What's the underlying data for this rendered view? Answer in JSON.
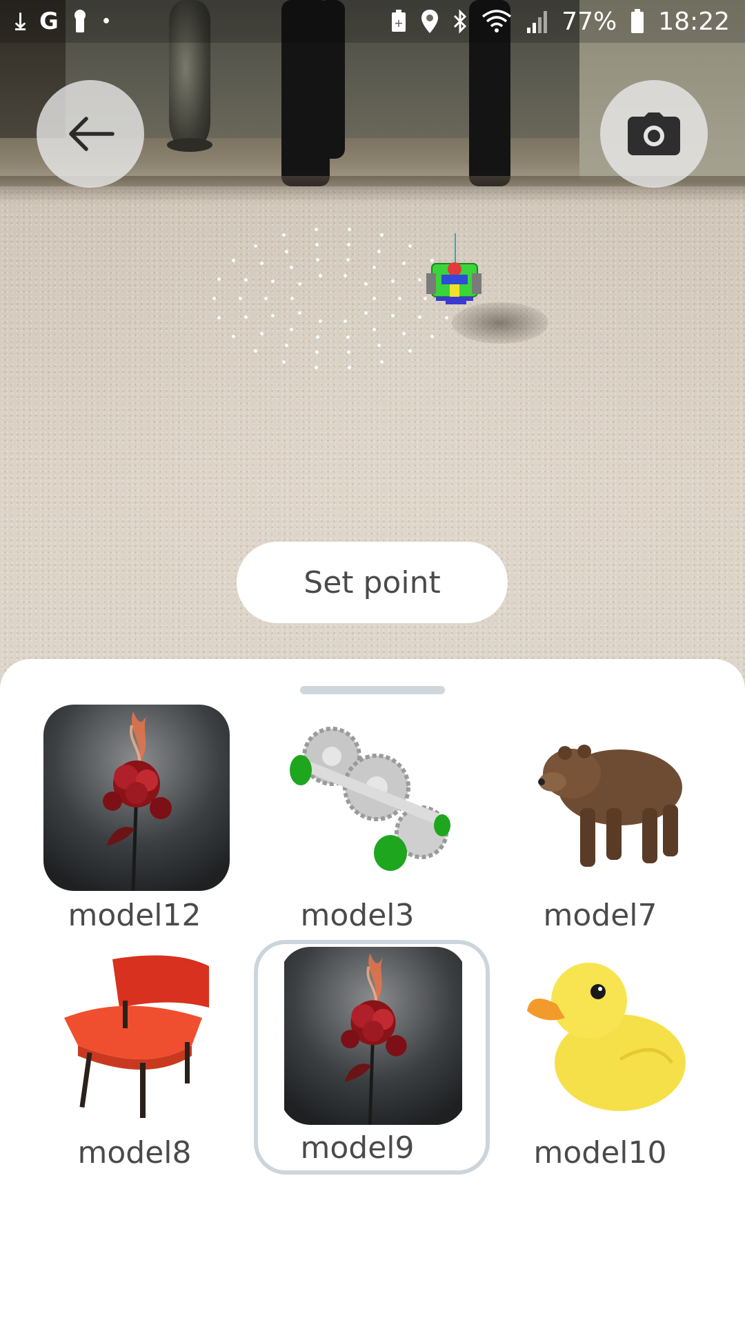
{
  "status_bar": {
    "left_icons": [
      "download-icon",
      "google-icon",
      "keyhole-icon",
      "dot-icon"
    ],
    "right_icons": [
      "battery-saver-icon",
      "location-icon",
      "bluetooth-icon",
      "wifi-icon",
      "signal-icon"
    ],
    "battery_percent": "77%",
    "time": "18:22"
  },
  "toolbar": {
    "back_icon": "arrow-left-icon",
    "camera_icon": "camera-icon"
  },
  "ar_scene": {
    "set_point_label": "Set point"
  },
  "model_picker": {
    "selected": "model9",
    "items": [
      {
        "label": "model12",
        "thumbnail": "rose-fire"
      },
      {
        "label": "model3",
        "thumbnail": "gear-assembly"
      },
      {
        "label": "model7",
        "thumbnail": "bear"
      },
      {
        "label": "model8",
        "thumbnail": "red-bench"
      },
      {
        "label": "model9",
        "thumbnail": "rose-fire"
      },
      {
        "label": "model10",
        "thumbnail": "rubber-duck"
      }
    ]
  },
  "colors": {
    "sheet_background": "#ffffff",
    "label_text": "#4a4a4a",
    "selection_border": "#cdd5dc",
    "round_button_bg": "#ebebeb"
  }
}
